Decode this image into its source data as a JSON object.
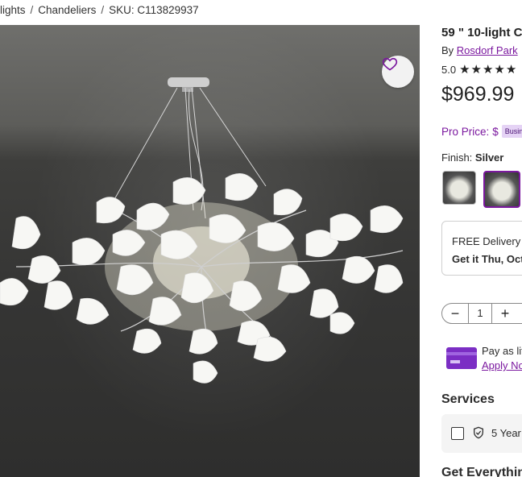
{
  "breadcrumb": {
    "items": [
      "lights",
      "Chandeliers",
      "SKU: C113829937"
    ],
    "separator": "/"
  },
  "product": {
    "title": "59 \" 10-light C",
    "by_prefix": "By",
    "brand": "Rosdorf Park",
    "rating_value": "5.0",
    "stars": "★★★★★",
    "rating_stars": 5,
    "price": "$969.99",
    "pro_price_label": "Pro Price:",
    "pro_price_value": "$",
    "pro_badge": "Busin",
    "finish_label": "Finish:",
    "finish_value": "Silver"
  },
  "delivery": {
    "line1": "FREE Delivery",
    "line2": "Get it Thu, Oct"
  },
  "quantity": {
    "minus": "−",
    "value": "1",
    "plus": "+"
  },
  "pay_later": {
    "line1": "Pay as lit",
    "link": "Apply No"
  },
  "services": {
    "heading": "Services",
    "protection_label": "5 Year"
  },
  "get_everything": {
    "heading": "Get Everythin"
  },
  "colors": {
    "accent": "#7b189f",
    "badge_bg": "#e5d3f5"
  },
  "icons": {
    "favorite": "heart-icon",
    "card": "credit-card-icon",
    "shield": "shield-check-icon"
  }
}
